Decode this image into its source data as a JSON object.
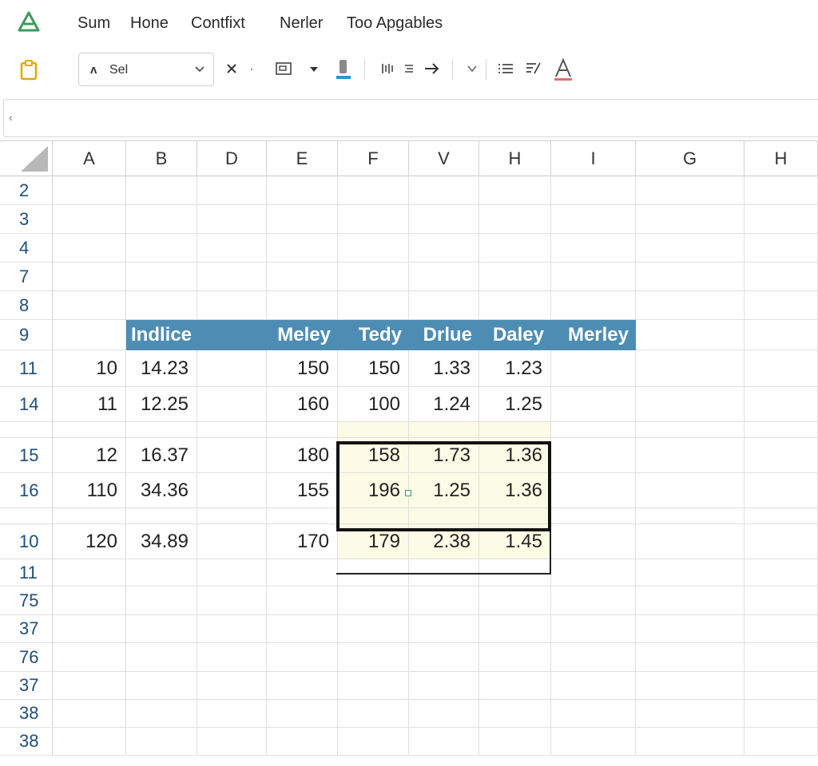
{
  "menu": {
    "items": [
      "Sum",
      "Hone",
      "Contfixt",
      "Nerler",
      "Too Apgables"
    ]
  },
  "toolbar": {
    "style_select_value": "Sel",
    "style_select_icon": "ʌ"
  },
  "colors": {
    "header_fill": "#4e8db3",
    "header_text": "#ffffff",
    "highlight_fill": "#fbfbe6",
    "logo_green": "#3a9a5a",
    "row_number": "#1f4e79"
  },
  "grid": {
    "columns": [
      "A",
      "B",
      "D",
      "E",
      "F",
      "V",
      "H",
      "I",
      "G",
      "H"
    ],
    "rows": [
      "2",
      "3",
      "4",
      "7",
      "8",
      "9",
      "11",
      "14",
      "",
      "15",
      "16",
      "",
      "10",
      "11",
      "75",
      "37",
      "76",
      "37",
      "38",
      "38"
    ],
    "table": {
      "header_row_label": "9",
      "headers": [
        "Indlice",
        "Meley",
        "Tedy",
        "Drlue",
        "Daley",
        "Merley"
      ],
      "rows": [
        [
          "10",
          "14.23",
          "",
          "150",
          "150",
          "1.33",
          "1.23",
          ""
        ],
        [
          "11",
          "12.25",
          "",
          "160",
          "100",
          "1.24",
          "1.25",
          ""
        ],
        [
          "",
          "",
          "",
          "",
          "",
          "",
          "",
          ""
        ],
        [
          "12",
          "16.37",
          "",
          "180",
          "158",
          "1.73",
          "1.36",
          ""
        ],
        [
          "110",
          "34.36",
          "",
          "155",
          "196",
          "1.25",
          "1.36",
          ""
        ],
        [
          "",
          "",
          "",
          "",
          "",
          "",
          "",
          ""
        ],
        [
          "120",
          "34.89",
          "",
          "170",
          "179",
          "2.38",
          "1.45",
          ""
        ]
      ]
    }
  }
}
